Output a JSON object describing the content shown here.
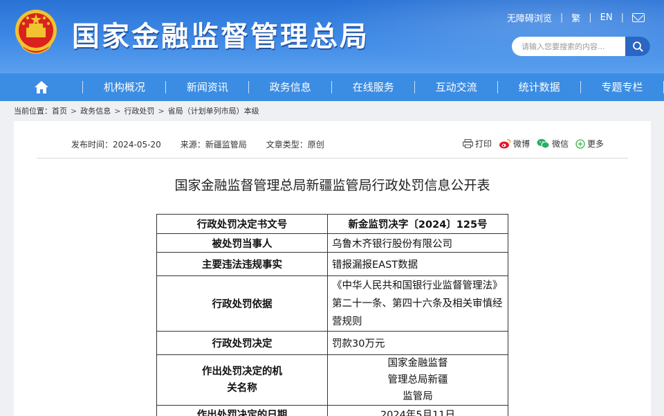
{
  "site": {
    "title": "国家金融监督管理总局"
  },
  "top_links": {
    "accessibility": "无障碍浏览",
    "traditional": "繁",
    "english": "EN",
    "mail_icon": "mail-icon"
  },
  "search": {
    "placeholder": "请输入您要搜索的内容..."
  },
  "nav": {
    "items": [
      "机构概况",
      "新闻资讯",
      "政务信息",
      "在线服务",
      "互动交流",
      "统计数据",
      "专题专栏"
    ]
  },
  "breadcrumb": {
    "label": "当前位置：",
    "items": [
      "首页",
      "政务信息",
      "行政处罚",
      "省局（计划单列市局）本级"
    ]
  },
  "meta": {
    "publish_time": "发布时间：2024-05-20",
    "source": "来源：新疆监管局",
    "type": "文章类型：原创"
  },
  "share": {
    "print": "打印",
    "weibo": "微博",
    "wechat": "微信",
    "more": "更多"
  },
  "article": {
    "title": "国家金融监督管理总局新疆监管局行政处罚信息公开表",
    "rows": [
      {
        "key": "行政处罚决定书文号",
        "value": "新金监罚决字〔2024〕125号"
      },
      {
        "key": "被处罚当事人",
        "value": "乌鲁木齐银行股份有限公司"
      },
      {
        "key": "主要违法违规事实",
        "value": "错报漏报EAST数据"
      },
      {
        "key": "行政处罚依据",
        "value": "《中华人民共和国银行业监督管理法》第二十一条、第四十六条及相关审慎经营规则"
      },
      {
        "key": "行政处罚决定",
        "value": "罚款30万元"
      },
      {
        "key": "作出处罚决定的机关名称",
        "value": "国家金融监督管理总局新疆监管局"
      },
      {
        "key": "作出处罚决定的日期",
        "value": "2024年5月11日"
      }
    ]
  },
  "colors": {
    "header": "#2a73d6",
    "nav": "#3b8ce3",
    "search_button": "#2a66c4"
  }
}
